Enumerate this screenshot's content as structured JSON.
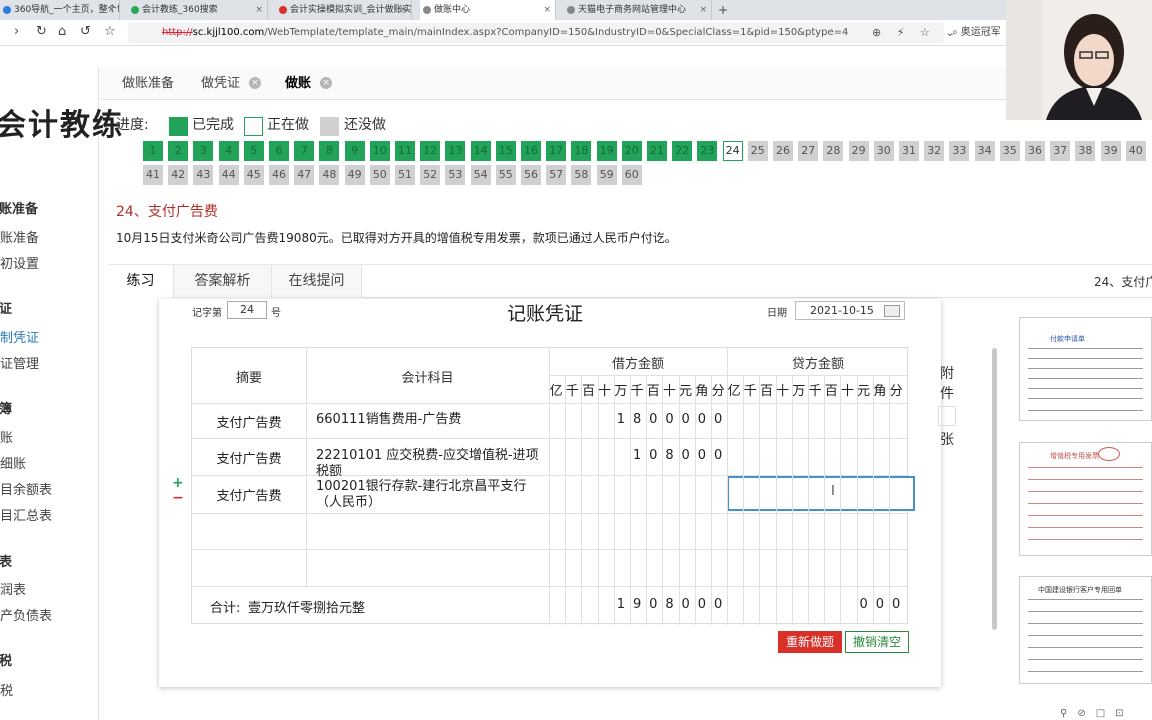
{
  "browser": {
    "tabs": [
      {
        "title": "360导航_一个主页，整个世界",
        "color": "#2b7de1"
      },
      {
        "title": "会计教练_360搜索",
        "color": "#2aa85a"
      },
      {
        "title": "会计实操模拟实训_会计做账实",
        "color": "#d9302a"
      },
      {
        "title": "做账中心",
        "color": "#888888"
      },
      {
        "title": "天猫电子商务网站管理中心",
        "color": "#888888"
      }
    ],
    "url_protocol": "http://",
    "url_domain": "sc.kjjl100.com",
    "url_path": "/WebTemplate/template_main/mainIndex.aspx?CompanyID=150&IndustryID=0&SpecialClass=1&pid=150&ptype=4",
    "search_text": "奥运冠军"
  },
  "sidebar": {
    "logo": "会计教练",
    "groups": [
      {
        "title": "建账准备",
        "items": [
          "建账准备",
          "期初设置"
        ]
      },
      {
        "title": "凭证",
        "items": [
          "填制凭证",
          "凭证管理"
        ]
      },
      {
        "title": "账簿",
        "items": [
          "总账",
          "明细账",
          "科目余额表",
          "科目汇总表"
        ]
      },
      {
        "title": "报表",
        "items": [
          "利润表",
          "资产负债表"
        ]
      },
      {
        "title": "纳税",
        "items": [
          "纳税"
        ]
      }
    ],
    "active_item": "填制凭证"
  },
  "top_tabs": [
    {
      "label": "做账准备"
    },
    {
      "label": "做凭证"
    },
    {
      "label": "做账"
    }
  ],
  "progress": {
    "label": "进度:",
    "legend": {
      "done": "已完成",
      "doing": "正在做",
      "todo": "还没做"
    },
    "current": 24,
    "total": 60,
    "done_color": "#22a35a",
    "todo_color": "#d0d0d0"
  },
  "question": {
    "title": "24、支付广告费",
    "description": "10月15日支付米奇公司广告费19080元。已取得对方开具的增值税专用发票，款项已通过人民币户付讫。"
  },
  "lower_tabs": {
    "tabs": [
      "练习",
      "答案解析",
      "在线提问"
    ],
    "right_label": "24、支付广告费"
  },
  "voucher": {
    "record_label": "记字第",
    "record_no": "24",
    "record_suffix": "号",
    "title": "记账凭证",
    "date_label": "日期",
    "date": "2021-10-15",
    "headers": {
      "summary": "摘要",
      "account": "会计科目",
      "debit": "借方金额",
      "credit": "贷方金额",
      "units": [
        "亿",
        "千",
        "百",
        "十",
        "万",
        "千",
        "百",
        "十",
        "元",
        "角",
        "分"
      ]
    },
    "rows": [
      {
        "summary": "支付广告费",
        "account": "660111销售费用-广告费",
        "debit_digits": [
          "",
          "",
          "",
          "",
          "1",
          "8",
          "0",
          "0",
          "0",
          "0",
          "0"
        ],
        "credit_digits": [
          "",
          "",
          "",
          "",
          "",
          "",
          "",
          "",
          "",
          "",
          ""
        ]
      },
      {
        "summary": "支付广告费",
        "account": "22210101 应交税费-应交增值税-进项税额",
        "debit_digits": [
          "",
          "",
          "",
          "",
          "",
          "1",
          "0",
          "8",
          "0",
          "0",
          "0"
        ],
        "credit_digits": [
          "",
          "",
          "",
          "",
          "",
          "",
          "",
          "",
          "",
          "",
          ""
        ]
      },
      {
        "summary": "支付广告费",
        "account": "100201银行存款-建行北京昌平支行（人民币）",
        "debit_digits": [
          "",
          "",
          "",
          "",
          "",
          "",
          "",
          "",
          "",
          "",
          ""
        ],
        "credit_digits": [
          "",
          "",
          "",
          "",
          "",
          "",
          "",
          "",
          "",
          "",
          ""
        ]
      },
      {
        "summary": "",
        "account": "",
        "debit_digits": [
          "",
          "",
          "",
          "",
          "",
          "",
          "",
          "",
          "",
          "",
          ""
        ],
        "credit_digits": [
          "",
          "",
          "",
          "",
          "",
          "",
          "",
          "",
          "",
          "",
          ""
        ]
      },
      {
        "summary": "",
        "account": "",
        "debit_digits": [
          "",
          "",
          "",
          "",
          "",
          "",
          "",
          "",
          "",
          "",
          ""
        ],
        "credit_digits": [
          "",
          "",
          "",
          "",
          "",
          "",
          "",
          "",
          "",
          "",
          ""
        ]
      }
    ],
    "total_label": "合计:",
    "total_text": "壹万玖仟零捌拾元整",
    "total_debit_digits": [
      "",
      "",
      "",
      "",
      "1",
      "9",
      "0",
      "8",
      "0",
      "0",
      "0"
    ],
    "total_credit_digits": [
      "",
      "",
      "",
      "",
      "",
      "",
      "",
      "",
      "0",
      "0",
      "0"
    ],
    "attach_label_1": "附",
    "attach_label_2": "件",
    "attach_label_3": "张",
    "btn_redo": "重新做题",
    "btn_clear": "撤销清空",
    "add_row": "+",
    "remove_row": "−"
  },
  "thumbnails": [
    {
      "title": "付款申请单"
    },
    {
      "title": "增值税专用发票"
    },
    {
      "title": "中国建设银行客户专用回单"
    }
  ]
}
